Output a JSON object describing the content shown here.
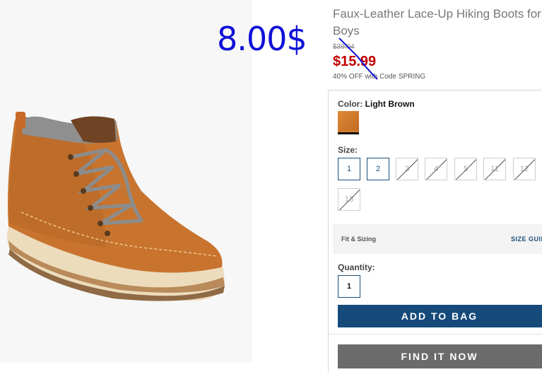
{
  "product": {
    "title": "Faux-Leather Lace-Up Hiking Boots for Boys",
    "original_price": "$39.94",
    "sale_price": "$15.99",
    "promo": "40% OFF with Code SPRING",
    "image_name": "boot-image"
  },
  "annotation": {
    "handwritten_price": "8.00$",
    "color": "#1010d8"
  },
  "options": {
    "color_label": "Color:",
    "color_value": "Light Brown",
    "swatch_color": "#d27a2c",
    "size_label": "Size:",
    "sizes": [
      {
        "label": "1",
        "available": true
      },
      {
        "label": "2",
        "available": true
      },
      {
        "label": "3",
        "available": false
      },
      {
        "label": "4",
        "available": false
      },
      {
        "label": "5",
        "available": false
      },
      {
        "label": "11",
        "available": false
      },
      {
        "label": "12",
        "available": false
      },
      {
        "label": "13",
        "available": false
      }
    ],
    "fit_label": "Fit & Sizing",
    "size_guide": "SIZE GUIDE",
    "quantity_label": "Quantity:",
    "quantity_value": "1"
  },
  "actions": {
    "add_to_bag": "ADD TO BAG",
    "find_it_now": "FIND IT NOW"
  },
  "colors": {
    "sale_red": "#c00000",
    "brand_blue": "#154a7a",
    "find_gray": "#6b6b6b"
  }
}
